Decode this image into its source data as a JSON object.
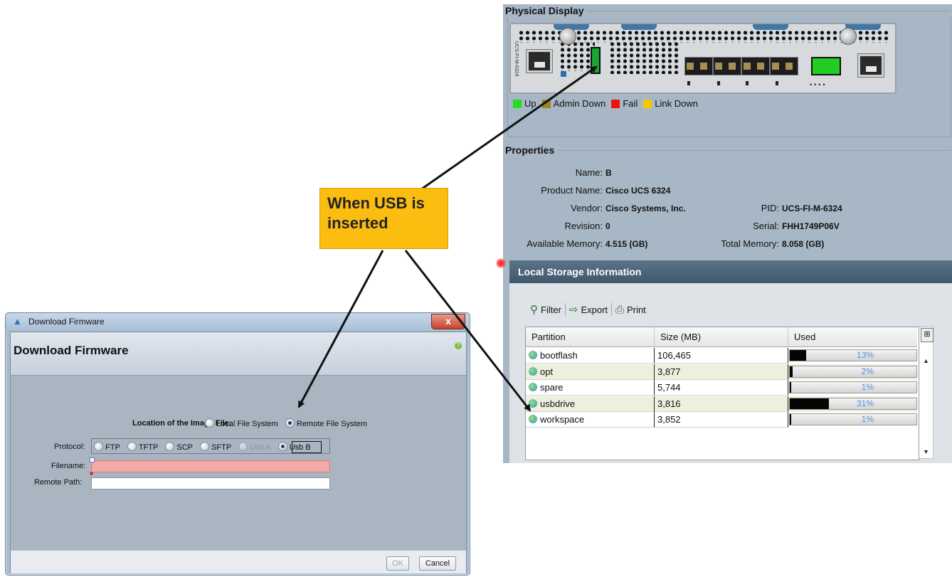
{
  "physical_display": {
    "title": "Physical Display",
    "device_label": "UCS-FI-M-6324",
    "legend": [
      {
        "label": "Up",
        "color": "#22dd22"
      },
      {
        "label": "Admin Down",
        "color": "#a08420"
      },
      {
        "label": "Fail",
        "color": "#ee1111"
      },
      {
        "label": "Link Down",
        "color": "#f5c800"
      }
    ]
  },
  "properties": {
    "title": "Properties",
    "name_label": "Name:",
    "name_value": "B",
    "product_label": "Product Name:",
    "product_value": "Cisco UCS 6324",
    "vendor_label": "Vendor:",
    "vendor_value": "Cisco Systems, Inc.",
    "pid_label": "PID:",
    "pid_value": "UCS-FI-M-6324",
    "revision_label": "Revision:",
    "revision_value": "0",
    "serial_label": "Serial:",
    "serial_value": "FHH1749P06V",
    "avail_mem_label": "Available Memory:",
    "avail_mem_value": "4.515 (GB)",
    "total_mem_label": "Total Memory:",
    "total_mem_value": "8.058 (GB)"
  },
  "local_storage": {
    "title": "Local Storage Information",
    "toolbar": {
      "filter": "Filter",
      "export": "Export",
      "print": "Print"
    },
    "columns": [
      "Partition",
      "Size (MB)",
      "Used"
    ],
    "rows": [
      {
        "partition": "bootflash",
        "size": "106,465",
        "used": "13%",
        "used_fraction": 0.13
      },
      {
        "partition": "opt",
        "size": "3,877",
        "used": "2%",
        "used_fraction": 0.02
      },
      {
        "partition": "spare",
        "size": "5,744",
        "used": "1%",
        "used_fraction": 0.01
      },
      {
        "partition": "usbdrive",
        "size": "3,816",
        "used": "31%",
        "used_fraction": 0.31
      },
      {
        "partition": "workspace",
        "size": "3,852",
        "used": "1%",
        "used_fraction": 0.01
      }
    ]
  },
  "callout": {
    "line1": "When USB is",
    "line2": "inserted",
    "color": "#fbbd10"
  },
  "dialog": {
    "window_title": "Download Firmware",
    "header_title": "Download Firmware",
    "close_glyph": "x",
    "location_label": "Location of the Image File:",
    "location_options": [
      {
        "label": "Local File System",
        "selected": false
      },
      {
        "label": "Remote File System",
        "selected": true
      }
    ],
    "protocol_label": "Protocol:",
    "protocol_options": [
      {
        "label": "FTP",
        "selected": false,
        "disabled": false
      },
      {
        "label": "TFTP",
        "selected": false,
        "disabled": false
      },
      {
        "label": "SCP",
        "selected": false,
        "disabled": false
      },
      {
        "label": "SFTP",
        "selected": false,
        "disabled": false
      },
      {
        "label": "Usb A",
        "selected": false,
        "disabled": true
      },
      {
        "label": "Usb B",
        "selected": true,
        "disabled": false
      }
    ],
    "filename_label": "Filename:",
    "filename_value": "",
    "remote_path_label": "Remote Path:",
    "remote_path_value": "",
    "ok_label": "OK",
    "cancel_label": "Cancel"
  }
}
